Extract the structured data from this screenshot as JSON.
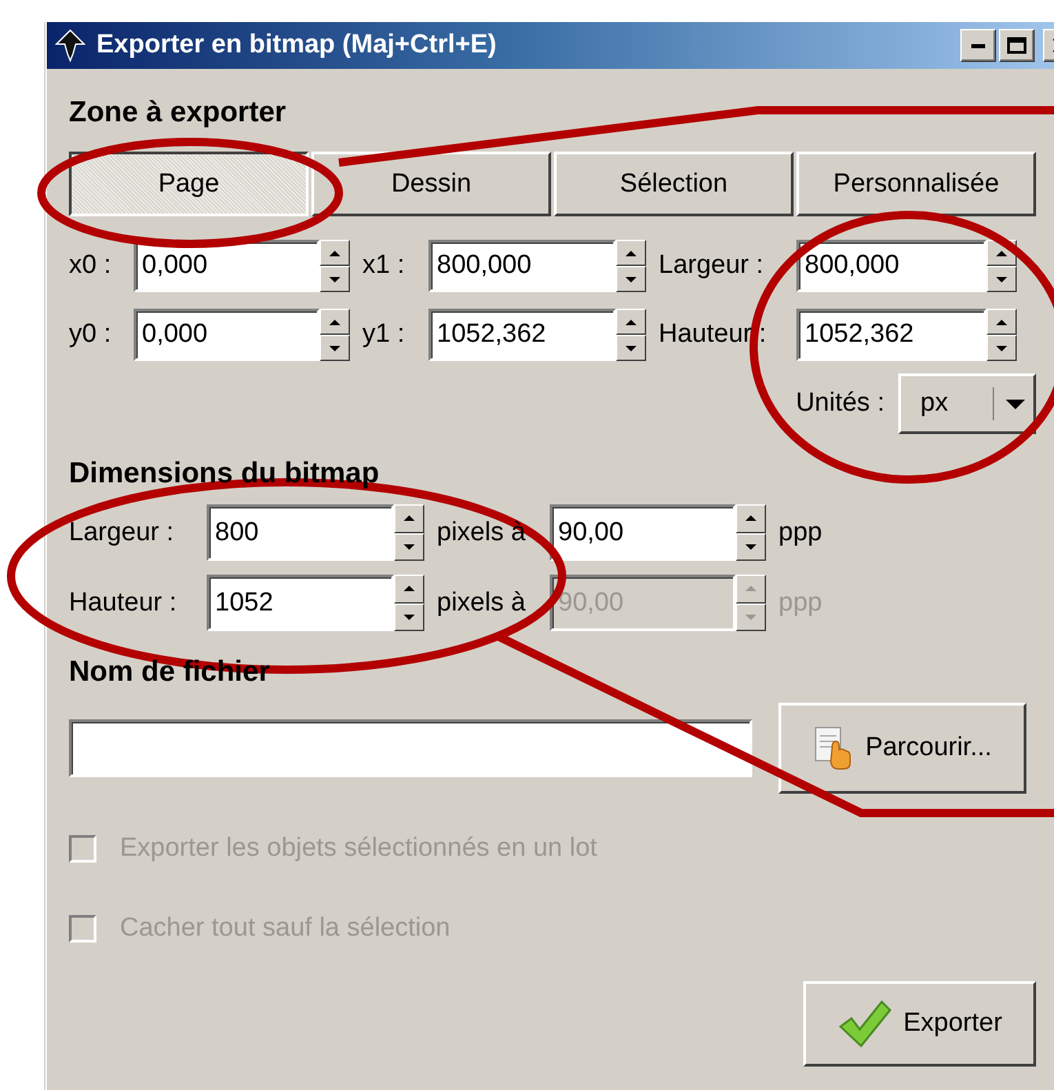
{
  "window": {
    "title": "Exporter en bitmap (Maj+Ctrl+E)"
  },
  "export_area": {
    "heading": "Zone à exporter",
    "tabs": [
      {
        "label": "Page",
        "selected": true
      },
      {
        "label": "Dessin",
        "selected": false
      },
      {
        "label": "Sélection",
        "selected": false
      },
      {
        "label": "Personnalisée",
        "selected": false
      }
    ],
    "rows": [
      {
        "fields": [
          {
            "label": "x0 :",
            "value": "0,000"
          },
          {
            "label": "x1 :",
            "value": "800,000"
          },
          {
            "label": "Largeur :",
            "value": "800,000"
          }
        ]
      },
      {
        "fields": [
          {
            "label": "y0 :",
            "value": "0,000"
          },
          {
            "label": "y1 :",
            "value": "1052,362"
          },
          {
            "label": "Hauteur :",
            "value": "1052,362"
          }
        ]
      }
    ],
    "units": {
      "label": "Unités :",
      "value": "px"
    }
  },
  "bitmap_size": {
    "heading": "Dimensions du bitmap",
    "rows": [
      {
        "label": "Largeur :",
        "value": "800",
        "unit_label": "pixels à",
        "dpi": "90,00",
        "dpi_unit": "ppp",
        "disabled": false
      },
      {
        "label": "Hauteur :",
        "value": "1052",
        "unit_label": "pixels à",
        "dpi": "90,00",
        "dpi_unit": "ppp",
        "disabled": true
      }
    ]
  },
  "filename": {
    "heading": "Nom de fichier",
    "browse_button": "Parcourir..."
  },
  "options": [
    {
      "label": "Exporter les objets sélectionnés en un lot",
      "checked": false,
      "disabled": true
    },
    {
      "label": "Cacher tout sauf la sélection",
      "checked": false,
      "disabled": true
    }
  ],
  "export_button": "Exporter"
}
